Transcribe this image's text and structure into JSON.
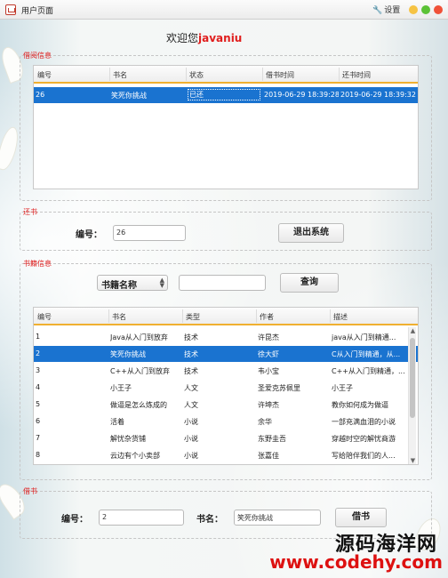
{
  "window": {
    "title": "用户页面",
    "settings_label": "设置"
  },
  "welcome": {
    "text": "欢迎您",
    "user": "javaniu"
  },
  "borrow_info": {
    "legend": "借阅信息",
    "columns": [
      "编号",
      "书名",
      "状态",
      "借书时间",
      "还书时间"
    ],
    "rows": [
      [
        "26",
        "笑死你挑战",
        "已还",
        "2019-06-29 18:39:28",
        "2019-06-29 18:39:32"
      ]
    ]
  },
  "return_book": {
    "legend": "还书",
    "id_label": "编号：",
    "id_value": "26",
    "exit_button": "退出系统"
  },
  "book_info": {
    "legend": "书籍信息",
    "search_select": "书籍名称",
    "search_value": "",
    "search_button": "查询",
    "columns": [
      "编号",
      "书名",
      "类型",
      "作者",
      "描述"
    ],
    "rows": [
      [
        "1",
        "Java从入门到放弃",
        "技术",
        "许昆杰",
        "java从入门到精通..."
      ],
      [
        "2",
        "笑死你挑战",
        "技术",
        "徐大虾",
        "C从入门到精通，从..."
      ],
      [
        "3",
        "C++从入门到放弃",
        "技术",
        "韦小宝",
        "C++从入门到精通，..."
      ],
      [
        "4",
        "小王子",
        "人文",
        "圣爱克苏佩里",
        "小王子"
      ],
      [
        "5",
        "做逼是怎么炼成的",
        "人文",
        "许坤杰",
        "教你如何成为做逼"
      ],
      [
        "6",
        "活着",
        "小说",
        "余华",
        "一部充满血泪的小说"
      ],
      [
        "7",
        "解忧杂货铺",
        "小说",
        "东野圭吾",
        "穿越时空的解忧商游"
      ],
      [
        "8",
        "云边有个小卖部",
        "小说",
        "张嘉佳",
        "写给陪伴我们的人..."
      ]
    ],
    "selected_row": 1
  },
  "borrow_book": {
    "legend": "借书",
    "id_label": "编号：",
    "id_value": "2",
    "name_label": "书名：",
    "name_value": "笑死你挑战",
    "borrow_button": "借书"
  },
  "watermark": {
    "cn": "源码海洋网",
    "en": "www.codehy.com"
  },
  "colors": {
    "accent": "#1a73d0",
    "legend": "#e01e1e",
    "header_underline": "#f0b030"
  }
}
